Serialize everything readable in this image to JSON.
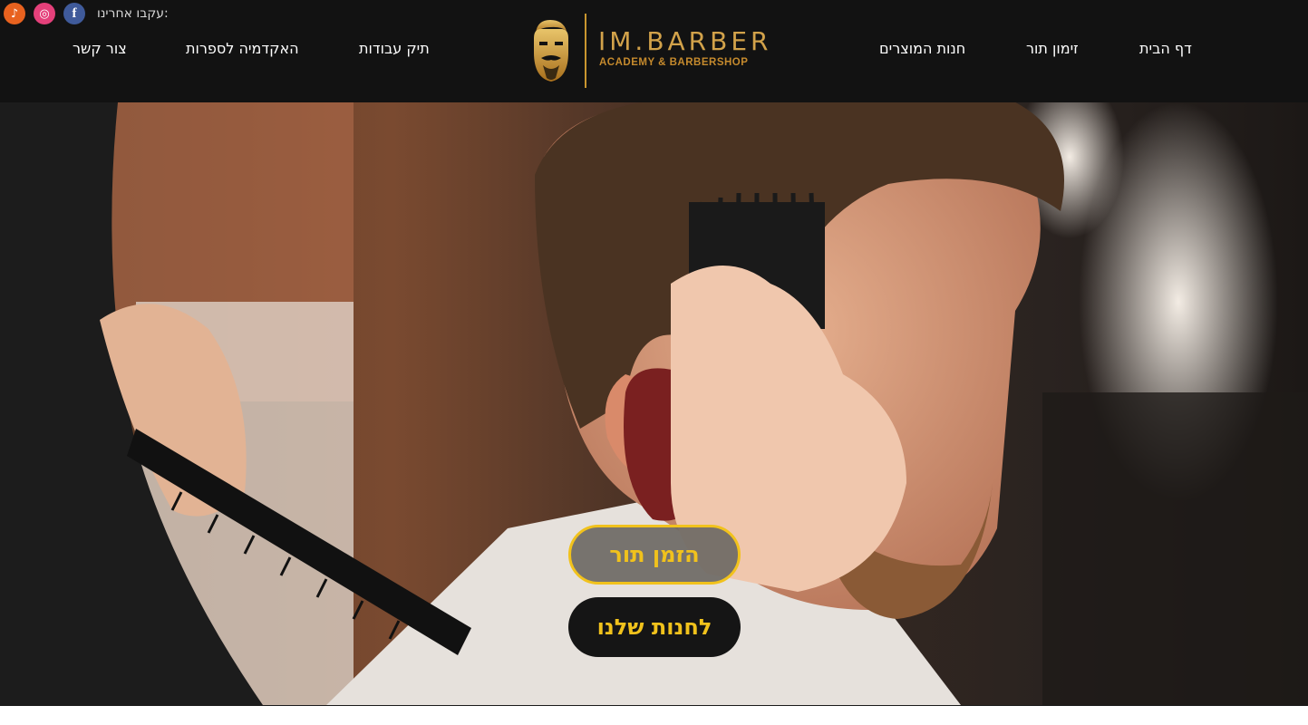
{
  "header": {
    "follow_label": "עקבו אחרינו:",
    "social": [
      {
        "name": "tiktok",
        "glyph": "♪"
      },
      {
        "name": "instagram",
        "glyph": "◎"
      },
      {
        "name": "facebook",
        "glyph": "f"
      }
    ],
    "nav": {
      "home": "דף הבית",
      "book": "זימון תור",
      "store": "חנות המוצרים",
      "portfolio": "תיק עבודות",
      "academy": "האקדמיה לספרות",
      "contact": "צור קשר"
    },
    "logo": {
      "title": "IM.BARBER",
      "subtitle": "ACADEMY & BARBERSHOP"
    }
  },
  "hero": {
    "book_button": "הזמן תור",
    "shop_button": "לחנות שלנו"
  },
  "colors": {
    "header_bg": "#121212",
    "accent_gold": "#f1c21c",
    "logo_gold": "#d2a24a"
  }
}
